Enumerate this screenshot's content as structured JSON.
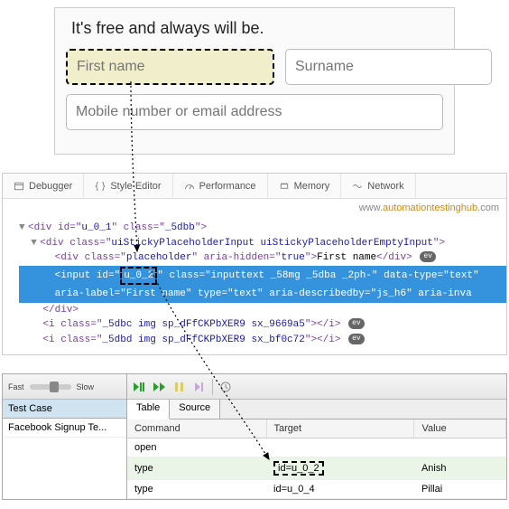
{
  "signup": {
    "tagline": "It's free and always will be.",
    "firstname_ph": "First name",
    "surname_ph": "Surname",
    "contact_ph": "Mobile number or email address"
  },
  "devtools": {
    "tabs": {
      "debugger": "Debugger",
      "style": "Style Editor",
      "perf": "Performance",
      "memory": "Memory",
      "network": "Network"
    },
    "watermark": {
      "pre": "www.",
      "accent": "automationtestinghub",
      "post": ".com"
    }
  },
  "source": {
    "line1_pre": "<div id=\"",
    "line1_id": "u_0_1",
    "line1_mid": "\" class=\"",
    "line1_class": "_5dbb",
    "line1_end": "\">",
    "line2_pre": "<div class=\"",
    "line2_class": "uiStickyPlaceholderInput uiStickyPlaceholderEmptyInput",
    "line2_end": "\">",
    "line3_pre": "<div class=\"",
    "line3_class": "placeholder",
    "line3_mid": "\" aria-hidden=\"",
    "line3_ah": "true",
    "line3_end": "\">",
    "line3_text": "First name",
    "line3_close": "</div>",
    "line4_pre": "<input",
    "line4_idlabel": " id=\"",
    "line4_id": "u_0_2",
    "line4_idend": "\"",
    "line4_rest1": " class=\"inputtext _58mg _5dba _2ph-\" data-type=\"text\"",
    "line5": "aria-label=\"First name\" type=\"text\" aria-describedby=\"js_h6\" aria-inva",
    "line6": "</div>",
    "line7_pre": "<i class=\"",
    "line7_class": "_5dbc img sp_dFfCKPbXER9 sx_9669a5",
    "line7_end": "\"></i>",
    "line8_pre": "<i class=\"",
    "line8_class": "_5dbd img sp_dFfCKPbXER9 sx_bf0c72",
    "line8_end": "\"></i>",
    "ev": "ev"
  },
  "ide": {
    "speed": {
      "fast": "Fast",
      "slow": "Slow"
    },
    "testcase_header": "Test Case",
    "testcase_item": "Facebook Signup Te...",
    "tabs": {
      "table": "Table",
      "source": "Source"
    },
    "cols": {
      "cmd": "Command",
      "target": "Target",
      "value": "Value"
    },
    "rows": [
      {
        "cmd": "open",
        "target": "",
        "value": ""
      },
      {
        "cmd": "type",
        "target": "id=u_0_2",
        "value": "Anish"
      },
      {
        "cmd": "type",
        "target": "id=u_0_4",
        "value": "Pillai"
      }
    ]
  }
}
